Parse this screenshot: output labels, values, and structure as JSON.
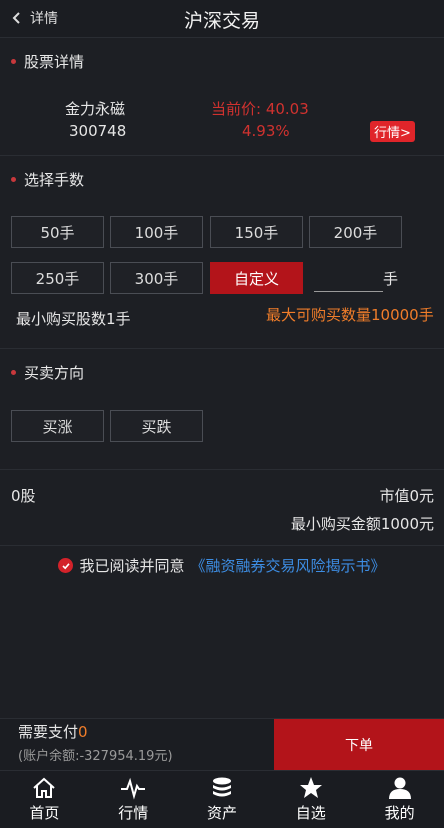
{
  "header": {
    "back_label": "详情",
    "title": "沪深交易"
  },
  "stock": {
    "section_title": "股票详情",
    "name": "金力永磁",
    "code": "300748",
    "price_label": "当前价:  40.03",
    "change": "4.93%",
    "quote_button": "行情>"
  },
  "lots": {
    "section_title": "选择手数",
    "options": [
      "50手",
      "100手",
      "150手",
      "200手",
      "250手",
      "300手",
      "自定义"
    ],
    "active_index": 6,
    "custom_value": "",
    "unit": "手",
    "min_text": "最小购买股数1手",
    "max_text": "最大可购买数量10000手"
  },
  "direction": {
    "section_title": "买卖方向",
    "buy_up": "买涨",
    "buy_down": "买跌"
  },
  "summary": {
    "shares": "0股",
    "market_value": "市值0元",
    "min_amount": "最小购买金额1000元"
  },
  "agreement": {
    "text": "我已阅读并同意",
    "link": "《融资融券交易风险揭示书》"
  },
  "payment": {
    "label": "需要支付",
    "value": "0",
    "balance": "(账户余额:-327954.19元)",
    "order_button": "下单"
  },
  "tabbar": {
    "items": [
      {
        "label": "首页",
        "icon": "home-icon"
      },
      {
        "label": "行情",
        "icon": "pulse-icon"
      },
      {
        "label": "资产",
        "icon": "coins-icon"
      },
      {
        "label": "自选",
        "icon": "star-icon"
      },
      {
        "label": "我的",
        "icon": "user-icon"
      }
    ]
  },
  "colors": {
    "accent_red": "#b3141a",
    "price_red": "#d0322f",
    "orange": "#f07d2a",
    "link_blue": "#3d8de3"
  }
}
